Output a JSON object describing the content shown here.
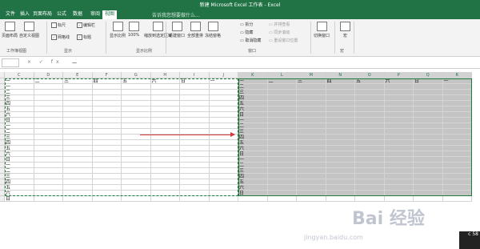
{
  "window": {
    "title": "新建 Microsoft Excel 工作表 - Excel"
  },
  "tabs": [
    {
      "label": "文件"
    },
    {
      "label": "插入"
    },
    {
      "label": "页面布局"
    },
    {
      "label": "公式"
    },
    {
      "label": "数据"
    },
    {
      "label": "审阅"
    },
    {
      "label": "视图",
      "active": true
    }
  ],
  "tellme": "告诉我您想要做什么...",
  "ribbon": {
    "buttons": [
      {
        "label": "页面布局"
      },
      {
        "label": "自定义视图"
      },
      {
        "label": "显示比例"
      },
      {
        "label": "100%"
      },
      {
        "label": "缩放到选定区域"
      },
      {
        "label": "新建窗口"
      },
      {
        "label": "全部重排"
      },
      {
        "label": "冻结窗格"
      },
      {
        "label": "切换窗口"
      },
      {
        "label": "宏"
      }
    ],
    "checks": [
      {
        "label": "标尺",
        "checked": false
      },
      {
        "label": "编辑栏",
        "checked": true
      },
      {
        "label": "网格线",
        "checked": true
      },
      {
        "label": "标题",
        "checked": true
      }
    ],
    "window_items": [
      "拆分",
      "隐藏",
      "取消隐藏"
    ],
    "sync_items": [
      "并排查看",
      "同步滚动",
      "重设窗口位置"
    ],
    "groups": [
      "工作簿视图",
      "显示",
      "显示比例",
      "窗口",
      "宏"
    ]
  },
  "formula_bar": {
    "fx_icons": "× ✓ fx",
    "value": "一"
  },
  "columns": [
    "C",
    "D",
    "E",
    "F",
    "G",
    "H",
    "I",
    "J",
    "K",
    "L",
    "M",
    "N",
    "O",
    "P",
    "Q",
    "R"
  ],
  "selected_columns": [
    "K",
    "L",
    "M",
    "N",
    "O",
    "P",
    "Q",
    "R"
  ],
  "header_row": [
    "一",
    "二",
    "三",
    "四",
    "五",
    "六",
    "日",
    "一"
  ],
  "left_col_values": [
    "一",
    "二",
    "三",
    "四",
    "五",
    "六",
    "日",
    "一",
    "二",
    "三",
    "四",
    "五",
    "六",
    "日",
    "一",
    "二",
    "三",
    "四",
    "五",
    "六",
    "日"
  ],
  "right_header": [
    "一",
    "二",
    "三",
    "四",
    "五",
    "六",
    "日",
    "一"
  ],
  "right_col_values": [
    "二",
    "三",
    "四",
    "五",
    "六",
    "日",
    "一",
    "二",
    "三",
    "四",
    "五",
    "六",
    "日",
    "一",
    "二",
    "三",
    "四",
    "五",
    "六",
    "日"
  ],
  "watermark": "Bai 经验",
  "watermark_url": "jingyan.baidu.com",
  "corner_text": "c 58"
}
